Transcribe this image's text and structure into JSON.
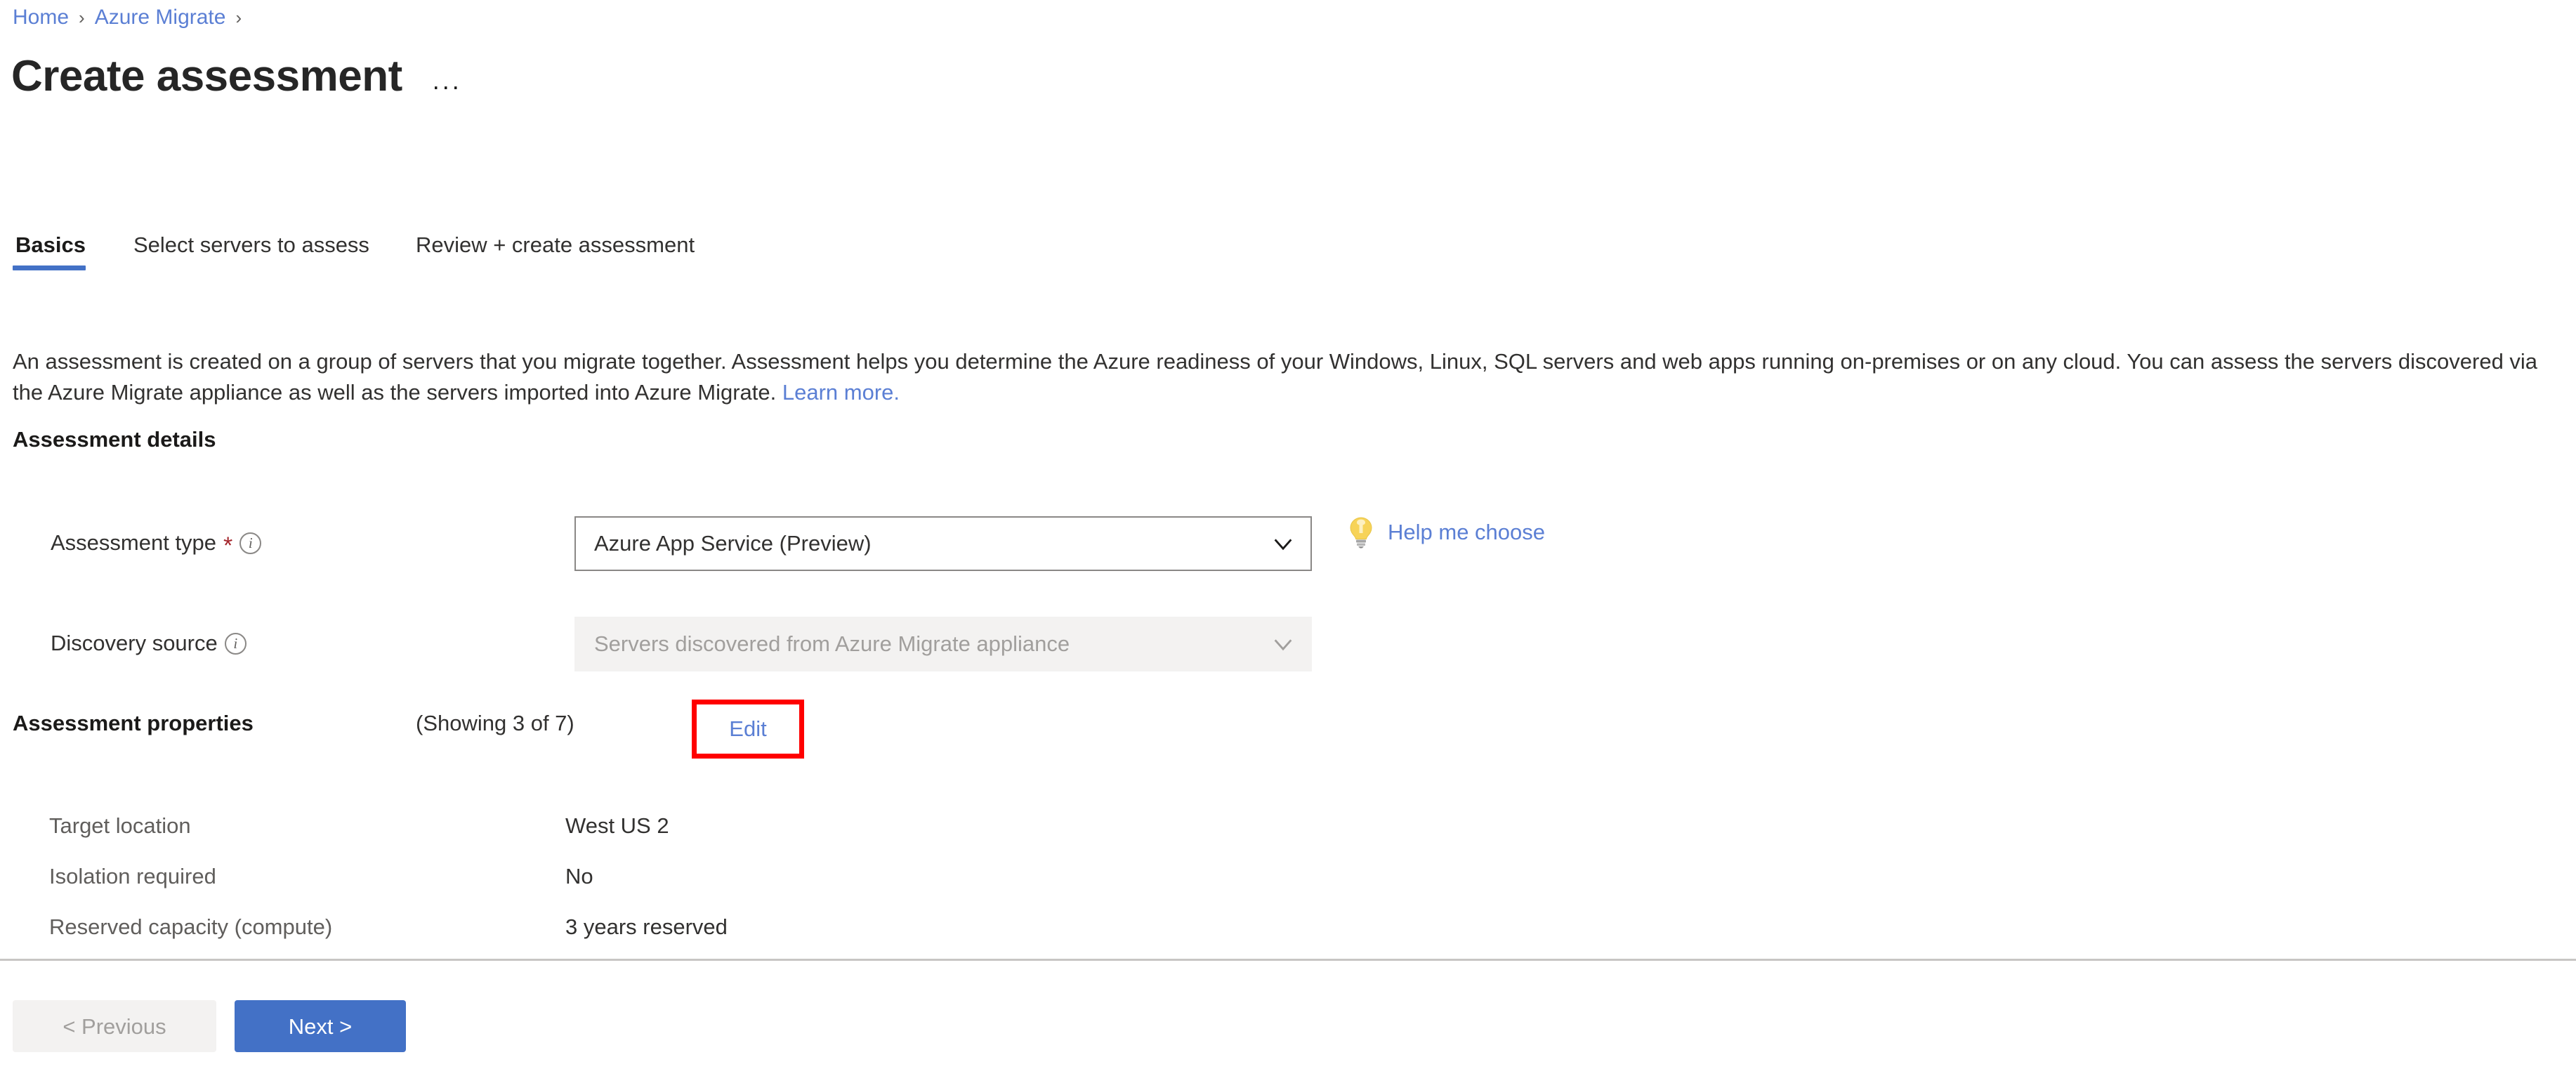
{
  "breadcrumb": {
    "items": [
      {
        "label": "Home",
        "is_link": true
      },
      {
        "label": "Azure Migrate",
        "is_link": true
      }
    ],
    "separator": "›"
  },
  "header": {
    "title": "Create assessment",
    "more_menu": "···"
  },
  "tabs": [
    {
      "label": "Basics",
      "active": true
    },
    {
      "label": "Select servers to assess",
      "active": false
    },
    {
      "label": "Review + create assessment",
      "active": false
    }
  ],
  "intro": {
    "text": "An assessment is created on a group of servers that you migrate together. Assessment helps you determine the Azure readiness of your Windows, Linux, SQL servers and web apps running on-premises or on any cloud. You can assess the servers discovered via the Azure Migrate appliance as well as the servers imported into Azure Migrate. ",
    "link_label": "Learn more."
  },
  "assessment_details": {
    "section_title": "Assessment details",
    "assessment_type": {
      "label": "Assessment type",
      "required_marker": "*",
      "info_icon": "info-icon",
      "value": "Azure App Service (Preview)",
      "help_link": "Help me choose",
      "help_icon": "lightbulb-icon"
    },
    "discovery_source": {
      "label": "Discovery source",
      "info_icon": "info-icon",
      "value": "Servers discovered from Azure Migrate appliance",
      "disabled": true
    }
  },
  "assessment_properties": {
    "heading": "Assessment properties",
    "count_text": "(Showing 3 of 7)",
    "edit_label": "Edit",
    "rows": [
      {
        "name": "Target location",
        "value": "West US 2"
      },
      {
        "name": "Isolation required",
        "value": "No"
      },
      {
        "name": "Reserved capacity (compute)",
        "value": "3 years reserved"
      }
    ]
  },
  "footer": {
    "previous_label": "< Previous",
    "next_label": "Next >"
  },
  "colors": {
    "link": "#5b7fd4",
    "primary": "#4371c6",
    "required": "#a4262c",
    "highlight": "#ff0000",
    "disabled_bg": "#f3f2f1",
    "divider": "#c8c6c4"
  }
}
